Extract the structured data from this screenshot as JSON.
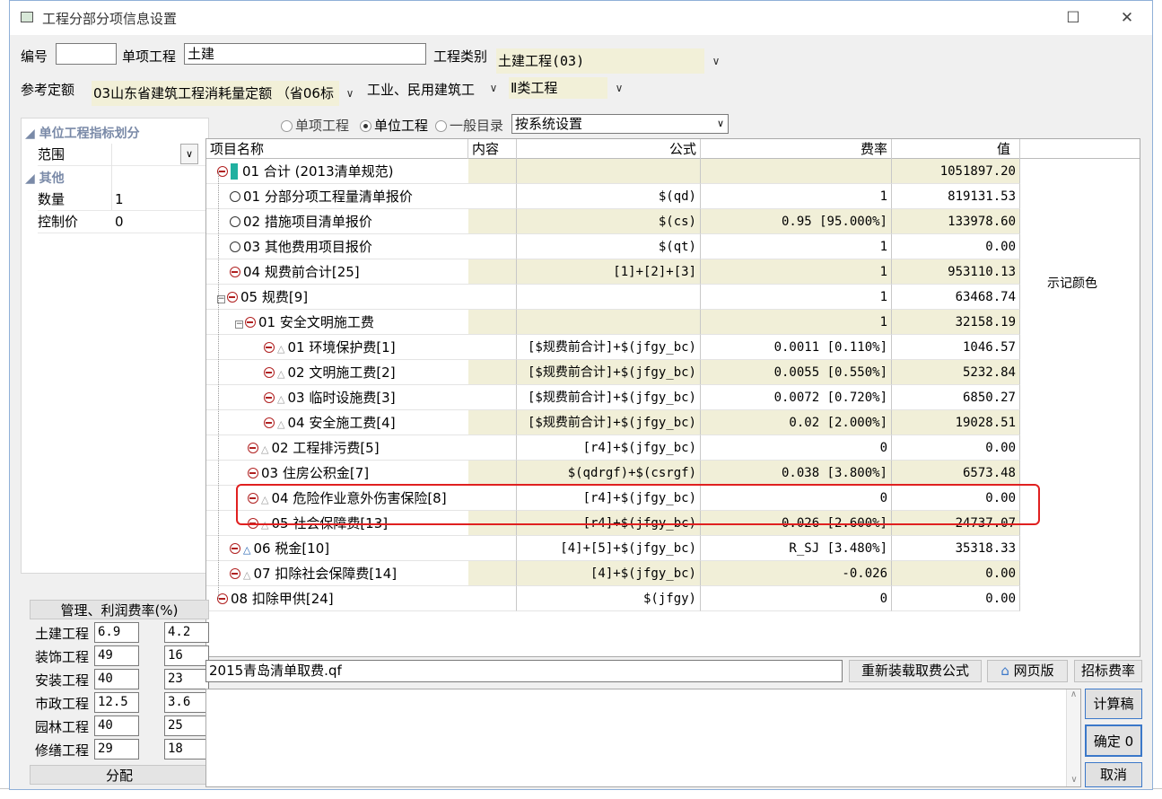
{
  "window": {
    "title": "工程分部分项信息设置"
  },
  "form": {
    "code_label": "编号",
    "code_value": "",
    "unit_label": "单项工程",
    "unit_value": "土建",
    "category_label": "工程类别",
    "category_value": "土建工程(03)",
    "quota_label": "参考定额",
    "quota_value": "03山东省建筑工程消耗量定额 （省06标",
    "building_type": "工业、民用建筑工",
    "class": "Ⅱ类工程"
  },
  "left_panel": {
    "section1": "单位工程指标划分",
    "range_label": "范围",
    "range_value": "",
    "section2": "其他",
    "qty_label": "数量",
    "qty_value": "1",
    "ctrl_label": "控制价",
    "ctrl_value": "0"
  },
  "options": {
    "radio1": "单项工程",
    "radio2": "单位工程",
    "radio3": "一般目录",
    "setting": "按系统设置"
  },
  "table": {
    "headers": [
      "项目名称",
      "内容",
      "公式",
      "费率",
      "值"
    ],
    "rows": [
      {
        "name": "01 合计 (2013清单规范)",
        "formula": "",
        "rate": "",
        "value": "1051897.20"
      },
      {
        "name": "01 分部分项工程量清单报价",
        "formula": "$(qd)",
        "rate": "1",
        "value": "819131.53"
      },
      {
        "name": "02 措施项目清单报价",
        "formula": "$(cs)",
        "rate": "0.95 [95.000%]",
        "value": "133978.60"
      },
      {
        "name": "03 其他费用项目报价",
        "formula": "$(qt)",
        "rate": "1",
        "value": "0.00"
      },
      {
        "name": "04 规费前合计[25]",
        "formula": "[1]+[2]+[3]",
        "rate": "1",
        "value": "953110.13"
      },
      {
        "name": "05 规费[9]",
        "formula": "",
        "rate": "1",
        "value": "63468.74"
      },
      {
        "name": "01 安全文明施工费",
        "formula": "",
        "rate": "1",
        "value": "32158.19"
      },
      {
        "name": "01 环境保护费[1]",
        "formula": "[$规费前合计]+$(jfgy_bc)",
        "rate": "0.0011 [0.110%]",
        "value": "1046.57"
      },
      {
        "name": "02 文明施工费[2]",
        "formula": "[$规费前合计]+$(jfgy_bc)",
        "rate": "0.0055 [0.550%]",
        "value": "5232.84"
      },
      {
        "name": "03 临时设施费[3]",
        "formula": "[$规费前合计]+$(jfgy_bc)",
        "rate": "0.0072 [0.720%]",
        "value": "6850.27"
      },
      {
        "name": "04 安全施工费[4]",
        "formula": "[$规费前合计]+$(jfgy_bc)",
        "rate": "0.02 [2.000%]",
        "value": "19028.51"
      },
      {
        "name": "02 工程排污费[5]",
        "formula": "[r4]+$(jfgy_bc)",
        "rate": "0",
        "value": "0.00"
      },
      {
        "name": "03 住房公积金[7]",
        "formula": "$(qdrgf)+$(csrgf)",
        "rate": "0.038 [3.800%]",
        "value": "6573.48"
      },
      {
        "name": "04 危险作业意外伤害保险[8]",
        "formula": "[r4]+$(jfgy_bc)",
        "rate": "0",
        "value": "0.00"
      },
      {
        "name": "05 社会保障费[13]",
        "formula": "[r4]+$(jfgy_bc)",
        "rate": "0.026 [2.600%]",
        "value": "24737.07"
      },
      {
        "name": "06 税金[10]",
        "formula": "[4]+[5]+$(jfgy_bc)",
        "rate": "R_SJ [3.480%]",
        "value": "35318.33"
      },
      {
        "name": "07 扣除社会保障费[14]",
        "formula": "[4]+$(jfgy_bc)",
        "rate": "-0.026",
        "value": "0.00"
      },
      {
        "name": "08 扣除甲供[24]",
        "formula": "$(jfgy)",
        "rate": "0",
        "value": "0.00"
      }
    ],
    "side_note": "示记颜色"
  },
  "rates": {
    "title": "管理、利润费率(%)",
    "rows": [
      {
        "label": "土建工程",
        "a": "6.9",
        "b": "4.2"
      },
      {
        "label": "装饰工程",
        "a": "49",
        "b": "16"
      },
      {
        "label": "安装工程",
        "a": "40",
        "b": "23"
      },
      {
        "label": "市政工程",
        "a": "12.5",
        "b": "3.6"
      },
      {
        "label": "园林工程",
        "a": "40",
        "b": "25"
      },
      {
        "label": "修缮工程",
        "a": "29",
        "b": "18"
      }
    ],
    "distribute": "分配"
  },
  "bottom": {
    "file": "2015青岛清单取费.qf",
    "reload": "重新装载取费公式",
    "web": "网页版",
    "bid": "招标费率",
    "calc": "计算稿",
    "ok": "确定 0",
    "cancel": "取消"
  },
  "colors": {
    "highlight": "#e02020",
    "yellow": "#f1efd8",
    "selected": "#3b78c9"
  }
}
